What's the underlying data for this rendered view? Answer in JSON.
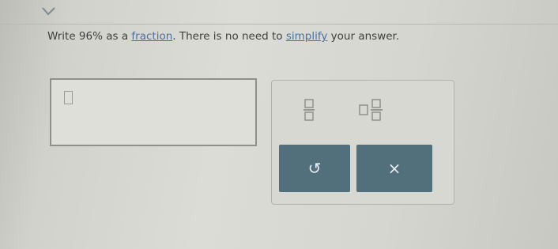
{
  "question": {
    "text_before": "Write 96% as a ",
    "link_fraction": "fraction",
    "text_middle": ". There is no need to ",
    "link_simplify": "simplify",
    "text_after": " your answer."
  },
  "answer": {
    "value": ""
  },
  "palette": {
    "fraction_icon": "fraction-template-icon",
    "mixed_number_icon": "mixed-number-template-icon",
    "undo_glyph": "↺",
    "clear_glyph": "×"
  },
  "colors": {
    "button_bg": "#526f7c",
    "link": "#4a6f9a"
  }
}
